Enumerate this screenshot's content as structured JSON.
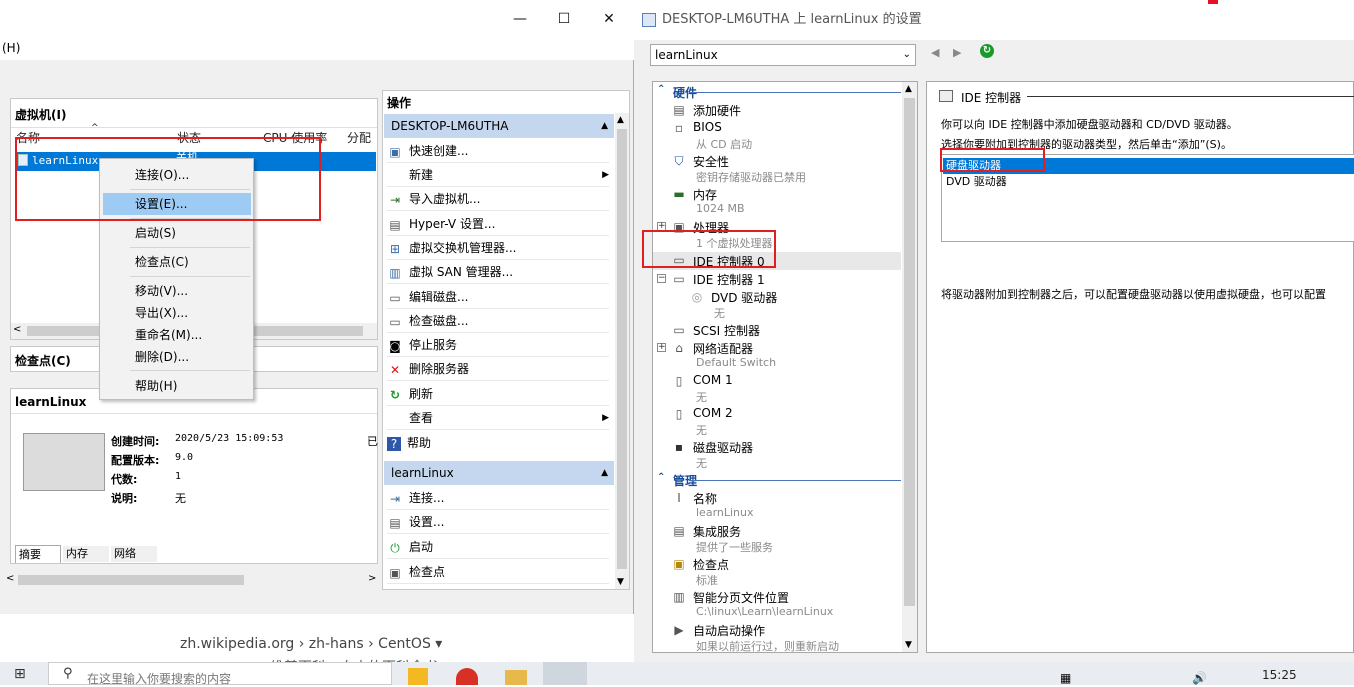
{
  "hyperv": {
    "menu_fragment": "(H)",
    "vm_panel_title": "虚拟机(I)",
    "columns": [
      "名称",
      "状态",
      "CPU 使用率",
      "分配"
    ],
    "vm_row": {
      "name": "learnLinux",
      "state": "关机"
    },
    "checkpoint_title": "检查点(C)",
    "details_title": "learnLinux",
    "details": [
      {
        "label": "创建时间:",
        "value": "2020/5/23 15:09:53"
      },
      {
        "label": "配置版本:",
        "value": "9.0"
      },
      {
        "label": "代数:",
        "value": "1"
      },
      {
        "label": "说明:",
        "value": "无"
      }
    ],
    "details_tabs": [
      "摘要",
      "内存",
      "网络"
    ],
    "details_cut": "已",
    "actions_title": "操作",
    "actions_host": "DESKTOP-LM6UTHA",
    "host_actions": [
      "快速创建...",
      "新建",
      "导入虚拟机...",
      "Hyper-V 设置...",
      "虚拟交换机管理器...",
      "虚拟 SAN 管理器...",
      "编辑磁盘...",
      "检查磁盘...",
      "停止服务",
      "删除服务器",
      "刷新",
      "查看",
      "帮助"
    ],
    "actions_vm": "learnLinux",
    "vm_actions": [
      "连接...",
      "设置...",
      "启动",
      "检查点"
    ],
    "context_menu": [
      "连接(O)...",
      "设置(E)...",
      "启动(S)",
      "检查点(C)",
      "移动(V)...",
      "导出(X)...",
      "重命名(M)...",
      "删除(D)...",
      "帮助(H)"
    ]
  },
  "settings": {
    "title": "DESKTOP-LM6UTHA 上 learnLinux 的设置",
    "vm_select": "learnLinux",
    "hardware_label": "硬件",
    "management_label": "管理",
    "hardware": [
      {
        "label": "添加硬件",
        "sub": "",
        "icon": "add-hardware-icon"
      },
      {
        "label": "BIOS",
        "sub": "从 CD 启动",
        "icon": "bios-icon"
      },
      {
        "label": "安全性",
        "sub": "密钥存储驱动器已禁用",
        "icon": "shield-icon"
      },
      {
        "label": "内存",
        "sub": "1024 MB",
        "icon": "memory-icon"
      },
      {
        "label": "处理器",
        "sub": "1 个虚拟处理器",
        "icon": "cpu-icon"
      },
      {
        "label": "IDE 控制器 0",
        "sub": "",
        "icon": "ide-icon"
      },
      {
        "label": "IDE 控制器 1",
        "sub": "",
        "icon": "ide-icon"
      },
      {
        "label": "DVD 驱动器",
        "sub": "无",
        "icon": "dvd-icon"
      },
      {
        "label": "SCSI 控制器",
        "sub": "",
        "icon": "scsi-icon"
      },
      {
        "label": "网络适配器",
        "sub": "Default Switch",
        "icon": "network-icon"
      },
      {
        "label": "COM 1",
        "sub": "无",
        "icon": "com-icon"
      },
      {
        "label": "COM 2",
        "sub": "无",
        "icon": "com-icon"
      },
      {
        "label": "磁盘驱动器",
        "sub": "无",
        "icon": "floppy-icon"
      }
    ],
    "management": [
      {
        "label": "名称",
        "sub": "learnLinux"
      },
      {
        "label": "集成服务",
        "sub": "提供了一些服务"
      },
      {
        "label": "检查点",
        "sub": "标准"
      },
      {
        "label": "智能分页文件位置",
        "sub": "C:\\linux\\Learn\\learnLinux"
      },
      {
        "label": "自动启动操作",
        "sub": "如果以前运行过，则重新启动"
      }
    ],
    "panel_heading": "IDE 控制器",
    "desc1": "你可以向 IDE 控制器中添加硬盘驱动器和 CD/DVD 驱动器。",
    "desc2": "选择你要附加到控制器的驱动器类型，然后单击“添加”(S)。",
    "drive_types": [
      "硬盘驱动器",
      "DVD 驱动器"
    ],
    "desc3": "将驱动器附加到控制器之后，可以配置硬盘驱动器以使用虚拟硬盘，也可以配置"
  },
  "background": {
    "breadcrumb": "zh.wikipedia.org › zh-hans › CentOS ▾",
    "behind_text": "维基百科，自由的百科全书"
  },
  "taskbar": {
    "search_placeholder": "在这里输入你要搜索的内容",
    "time": "15:25"
  }
}
